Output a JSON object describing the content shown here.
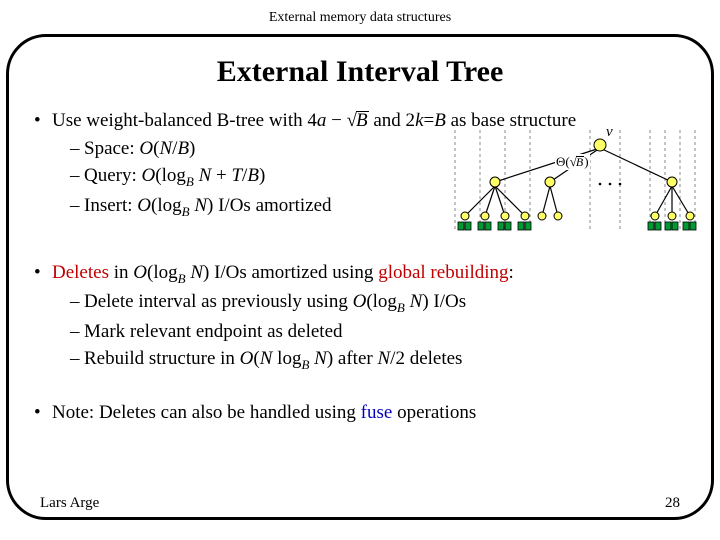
{
  "header": "External memory data structures",
  "title": "External Interval Tree",
  "footer": {
    "author": "Lars Arge",
    "page": "28"
  },
  "bullets": {
    "b1": {
      "lead": "Use weight-balanced B-tree with ",
      "tail": " as base structure",
      "a": {
        "four": "4",
        "a": "a",
        "minus": " − ",
        "sqrt": "√",
        "rad": "B",
        "and": " and 2",
        "k": "k",
        "eq": "=",
        "B": "B"
      },
      "s1": {
        "label": "Space: ",
        "O": "O",
        "open": "(",
        "N": "N",
        "slash": "/",
        "B": "B",
        "close": ")"
      },
      "s2": {
        "label": "Query: ",
        "O": "O",
        "open": "(log",
        "sub": "B",
        "sp": " ",
        "N": "N",
        "plus": " + ",
        "T": "T",
        "slash": "/",
        "B2": "B",
        "close": ")"
      },
      "s3": {
        "label": "Insert: ",
        "O": "O",
        "open": "(log",
        "sub": "B",
        "sp": " ",
        "N": "N",
        "close": ") ",
        "tail": "I/Os amortized"
      }
    },
    "b2": {
      "lead_red": "Deletes",
      "in": " in ",
      "O": "O",
      "open": "(log",
      "sub": "B",
      "sp": " ",
      "N": "N",
      "close": ") ",
      "mid": "I/Os amortized using ",
      "gr_red": "global rebuilding",
      "colon": ":",
      "s1": {
        "label": "Delete interval as previously using ",
        "O": "O",
        "open": "(log",
        "sub": "B",
        "sp": " ",
        "N": "N",
        "close": ") ",
        "tail": "I/Os"
      },
      "s2": {
        "label": "Mark relevant endpoint as deleted"
      },
      "s3": {
        "label": "Rebuild structure in ",
        "O": "O",
        "open": "(",
        "N1": "N",
        "log": " log",
        "sub": "B",
        "sp": " ",
        "N2": "N",
        "close": ") ",
        "after": "after ",
        "Nh": "N",
        "half": "/2",
        "tail": " deletes"
      }
    },
    "b3": {
      "text1": "Note: Deletes can also be handled using ",
      "fuse_blue": "fuse",
      "text2": " operations"
    }
  },
  "tree": {
    "v": "v",
    "theta_sym": "Θ",
    "theta_open": "(",
    "sqrt": "√",
    "rad": "B",
    "theta_close": ")"
  }
}
